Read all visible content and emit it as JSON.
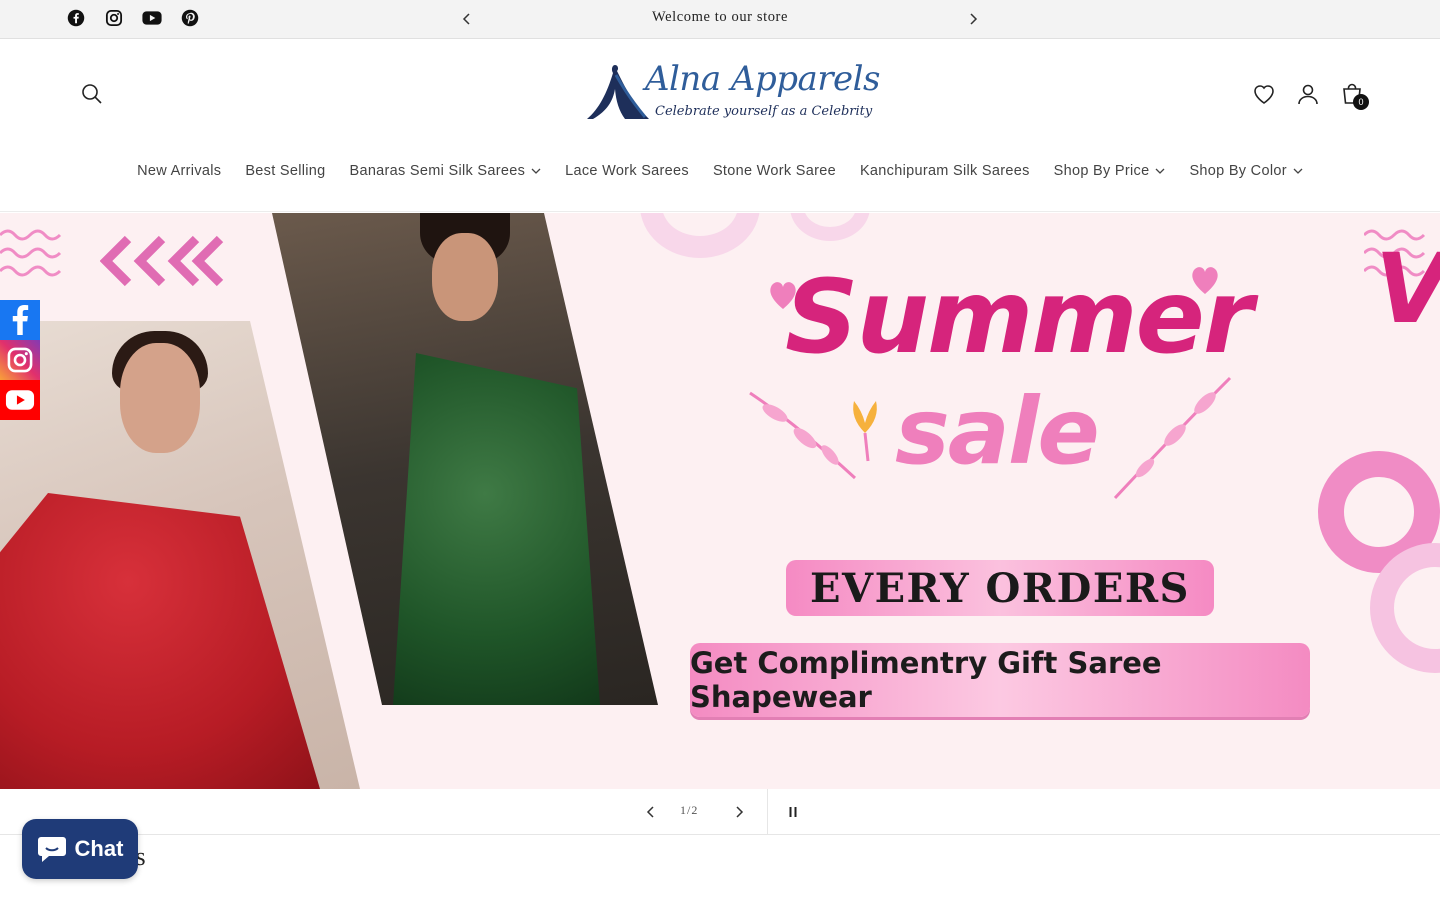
{
  "announcement": {
    "text": "Welcome to our store",
    "prev_icon": "chevron-left-icon",
    "next_icon": "chevron-right-icon"
  },
  "top_social": [
    "facebook-icon",
    "instagram-icon",
    "youtube-icon",
    "pinterest-icon"
  ],
  "header": {
    "logo_title": "Alna Apparels",
    "logo_tagline": "Celebrate yourself as a Celebrity",
    "cart_count": "0"
  },
  "nav": {
    "items": [
      {
        "label": "New Arrivals",
        "dropdown": false
      },
      {
        "label": "Best Selling",
        "dropdown": false
      },
      {
        "label": "Banaras Semi Silk Sarees",
        "dropdown": true
      },
      {
        "label": "Lace Work Sarees",
        "dropdown": false
      },
      {
        "label": "Stone Work Saree",
        "dropdown": false
      },
      {
        "label": "Kanchipuram Silk Sarees",
        "dropdown": false
      },
      {
        "label": "Shop By Price",
        "dropdown": true
      },
      {
        "label": "Shop By Color",
        "dropdown": true
      }
    ]
  },
  "hero": {
    "headline_1": "Summer",
    "headline_2": "sale",
    "badge_1": "EVERY ORDERS",
    "badge_2": "Get Complimentry Gift Saree Shapewear",
    "edge_letter": "V"
  },
  "slideshow": {
    "counter": "1/2"
  },
  "section": {
    "title": "tions"
  },
  "chat": {
    "label": "Chat"
  },
  "colors": {
    "brand_blue": "#2f5d9a",
    "summer_pink": "#d6247c",
    "chat_bg": "#1f3b78"
  }
}
